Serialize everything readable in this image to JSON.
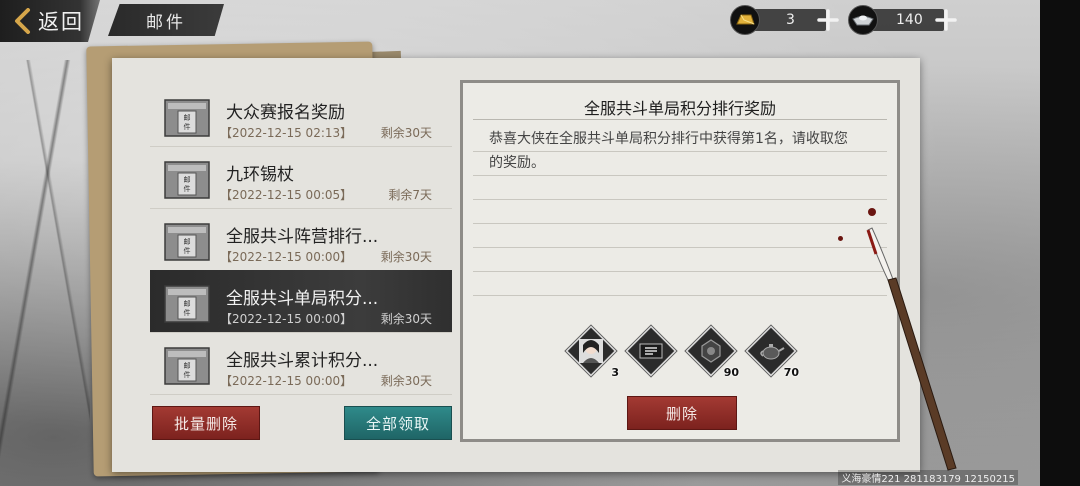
{
  "header": {
    "back_label": "返回",
    "tab_label": "邮件",
    "gold_amount": "3",
    "silver_amount": "140"
  },
  "mail_list": {
    "items": [
      {
        "title": "大众赛报名奖励",
        "date": "【2022-12-15 02:13】",
        "remain": "剩余30天",
        "selected": false
      },
      {
        "title": "九环锡杖",
        "date": "【2022-12-15 00:05】",
        "remain": "剩余7天",
        "selected": false
      },
      {
        "title": "全服共斗阵营排行...",
        "date": "【2022-12-15 00:00】",
        "remain": "剩余30天",
        "selected": false
      },
      {
        "title": "全服共斗单局积分...",
        "date": "【2022-12-15 00:00】",
        "remain": "剩余30天",
        "selected": true
      },
      {
        "title": "全服共斗累计积分...",
        "date": "【2022-12-15 00:00】",
        "remain": "剩余30天",
        "selected": false
      }
    ],
    "envelope_text": "邮件"
  },
  "actions": {
    "batch_delete": "批量删除",
    "claim_all": "全部领取"
  },
  "detail": {
    "title": "全服共斗单局积分排行奖励",
    "body": "恭喜大侠在全服共斗单局积分排行中获得第1名，请收取您的奖励。",
    "rewards": [
      {
        "icon": "character-portrait-icon",
        "count": "3"
      },
      {
        "icon": "seal-scroll-icon",
        "count": ""
      },
      {
        "icon": "bronze-token-icon",
        "count": "90"
      },
      {
        "icon": "teapot-icon",
        "count": "70"
      }
    ],
    "delete_label": "删除"
  },
  "footer": {
    "watermark": "义海豪情221 281183179 12150215"
  },
  "colors": {
    "red_button": "#8f2d27",
    "teal_button": "#277677",
    "paper": "#e4e3de"
  }
}
